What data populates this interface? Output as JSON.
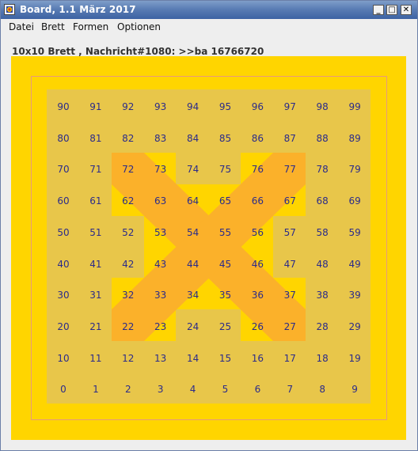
{
  "window": {
    "title": "Board, 1.1 März 2017",
    "buttons": {
      "minimize": "_",
      "maximize": "□",
      "close": "✕"
    }
  },
  "menu": {
    "items": [
      "Datei",
      "Brett",
      "Formen",
      "Optionen"
    ]
  },
  "status": {
    "text": "10x10 Brett , Nachricht#1080: >>ba 16766720"
  },
  "board": {
    "rows": 10,
    "cols": 10,
    "numbers_by_row": [
      [
        "90",
        "91",
        "92",
        "93",
        "94",
        "95",
        "96",
        "97",
        "98",
        "99"
      ],
      [
        "80",
        "81",
        "82",
        "83",
        "84",
        "85",
        "86",
        "87",
        "88",
        "89"
      ],
      [
        "70",
        "71",
        "72",
        "73",
        "74",
        "75",
        "76",
        "77",
        "78",
        "79"
      ],
      [
        "60",
        "61",
        "62",
        "63",
        "64",
        "65",
        "66",
        "67",
        "68",
        "69"
      ],
      [
        "50",
        "51",
        "52",
        "53",
        "54",
        "55",
        "56",
        "57",
        "58",
        "59"
      ],
      [
        "40",
        "41",
        "42",
        "43",
        "44",
        "45",
        "46",
        "47",
        "48",
        "49"
      ],
      [
        "30",
        "31",
        "32",
        "33",
        "34",
        "35",
        "36",
        "37",
        "38",
        "39"
      ],
      [
        "20",
        "21",
        "22",
        "23",
        "24",
        "25",
        "26",
        "27",
        "28",
        "29"
      ],
      [
        "10",
        "11",
        "12",
        "13",
        "14",
        "15",
        "16",
        "17",
        "18",
        "19"
      ],
      [
        "0",
        "1",
        "2",
        "3",
        "4",
        "5",
        "6",
        "7",
        "8",
        "9"
      ]
    ],
    "highlighted_cells": [
      "72",
      "73",
      "62",
      "63",
      "53",
      "54",
      "55",
      "43",
      "44",
      "45",
      "32",
      "33",
      "22",
      "23",
      "76",
      "77",
      "66",
      "67",
      "56",
      "46",
      "36",
      "37",
      "26",
      "27",
      "64",
      "65",
      "34",
      "35"
    ],
    "colors": {
      "background": "#ffd500",
      "grid": "#e8c64a",
      "cross": "#fbb12a",
      "number": "#2b2b8a"
    }
  }
}
